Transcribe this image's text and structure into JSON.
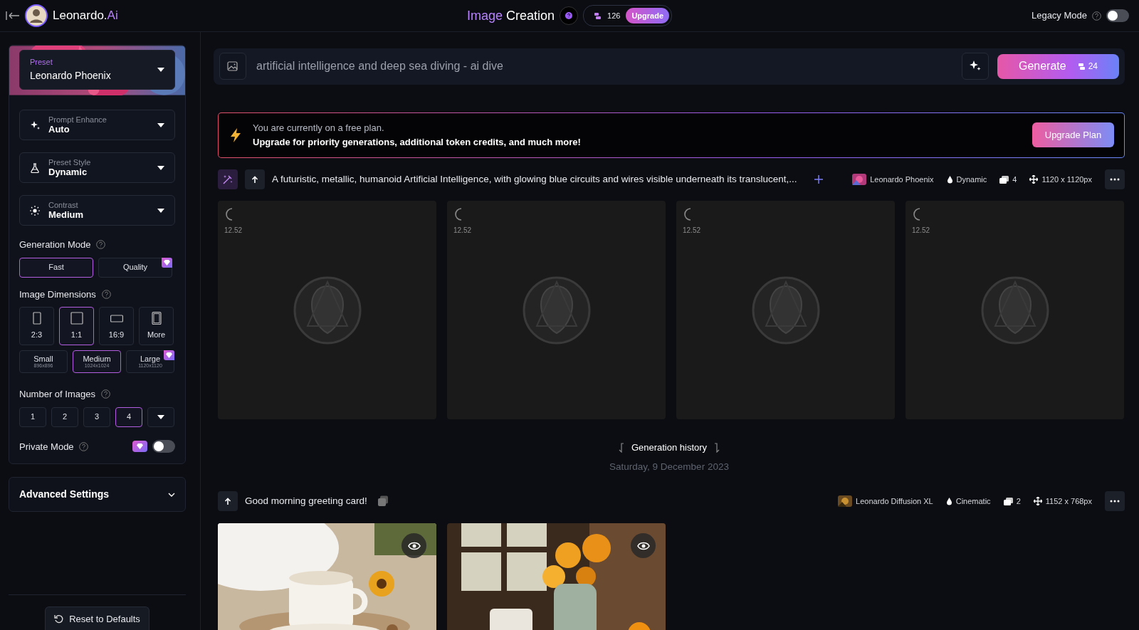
{
  "header": {
    "brand": "Leonardo.",
    "brand_accent": "Ai",
    "title_accent": "Image",
    "title": "Creation",
    "tokens": "126",
    "upgrade_button": "Upgrade",
    "legacy_mode": {
      "label": "Legacy Mode",
      "on": false
    }
  },
  "sidebar": {
    "preset": {
      "label": "Preset",
      "value": "Leonardo Phoenix"
    },
    "dropdowns": [
      {
        "kind": "sparkles",
        "label": "Prompt Enhance",
        "value": "Auto"
      },
      {
        "kind": "flask",
        "label": "Preset Style",
        "value": "Dynamic"
      },
      {
        "kind": "sun",
        "label": "Contrast",
        "value": "Medium"
      }
    ],
    "generation_mode": {
      "title": "Generation Mode",
      "options": [
        {
          "label": "Fast",
          "selected": true,
          "premium": false
        },
        {
          "label": "Quality",
          "selected": false,
          "premium": true
        }
      ]
    },
    "image_dimensions": {
      "title": "Image Dimensions",
      "ratios": [
        {
          "kind": "portrait",
          "label": "2:3",
          "selected": false
        },
        {
          "kind": "square",
          "label": "1:1",
          "selected": true
        },
        {
          "kind": "wide",
          "label": "16:9",
          "selected": false
        },
        {
          "kind": "more",
          "label": "More",
          "selected": false
        }
      ],
      "sizes": [
        {
          "label": "Small",
          "detail": "896x896",
          "selected": false,
          "premium": false
        },
        {
          "label": "Medium",
          "detail": "1024x1024",
          "selected": true,
          "premium": false
        },
        {
          "label": "Large",
          "detail": "1120x1120",
          "selected": false,
          "premium": true
        }
      ]
    },
    "number_of_images": {
      "title": "Number of Images",
      "options": [
        {
          "label": "1",
          "selected": false
        },
        {
          "label": "2",
          "selected": false
        },
        {
          "label": "3",
          "selected": false
        },
        {
          "label": "4",
          "selected": true
        }
      ]
    },
    "private_mode": {
      "label": "Private Mode",
      "premium": true,
      "on": false
    },
    "advanced_settings": {
      "label": "Advanced Settings",
      "expanded": false
    },
    "reset_button": "Reset to Defaults"
  },
  "prompt_bar": {
    "value": "artificial intelligence and deep sea diving - ai dive",
    "generate_button": "Generate",
    "cost": "24"
  },
  "banner": {
    "line_1": "You are currently on a free plan.",
    "line_2": "Upgrade for priority generations, additional token credits, and much more!",
    "button": "Upgrade Plan"
  },
  "current_generation": {
    "prompt": "A futuristic, metallic, humanoid Artificial Intelligence, with glowing blue circuits and wires visible underneath its translucent,...",
    "model": "Leonardo Phoenix",
    "style": "Dynamic",
    "count": "4",
    "size": "1120 x 1120px",
    "items": [
      {
        "kind": "loading",
        "time": "12.52"
      },
      {
        "kind": "loading",
        "time": "12.52"
      },
      {
        "kind": "loading",
        "time": "12.52"
      },
      {
        "kind": "loading",
        "time": "12.52"
      }
    ]
  },
  "history": {
    "title": "Generation history",
    "date": "Saturday, 9 December 2023",
    "generations": [
      {
        "prompt": "Good morning greeting card!",
        "model": "Leonardo Diffusion XL",
        "style": "Cinematic",
        "count": "2",
        "size": "1152 x 768px"
      }
    ]
  }
}
